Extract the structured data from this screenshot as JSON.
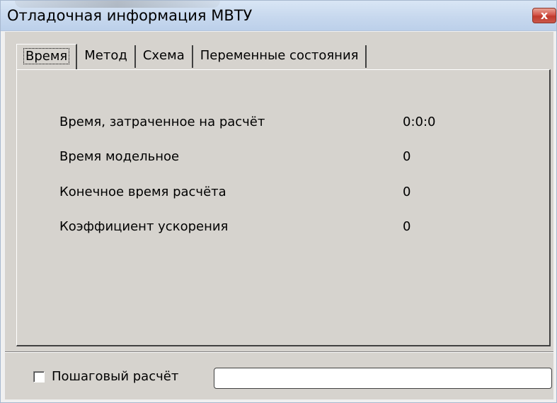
{
  "window": {
    "title": "Отладочная информация МВТУ",
    "close_icon": "close-icon",
    "close_glyph": "x"
  },
  "tabs": [
    {
      "label": "Время",
      "active": true
    },
    {
      "label": "Метод",
      "active": false
    },
    {
      "label": "Схема",
      "active": false
    },
    {
      "label": "Переменные состояния",
      "active": false
    }
  ],
  "time_panel": {
    "rows": [
      {
        "label": "Время, затраченное на расчёт",
        "value": "0:0:0"
      },
      {
        "label": "Время модельное",
        "value": "0"
      },
      {
        "label": "Конечное время расчёта",
        "value": "0"
      },
      {
        "label": "Коэффициент ускорения",
        "value": "0"
      }
    ]
  },
  "footer": {
    "step_checkbox_label": "Пошаговый расчёт",
    "step_checked": false,
    "progress": 0
  }
}
